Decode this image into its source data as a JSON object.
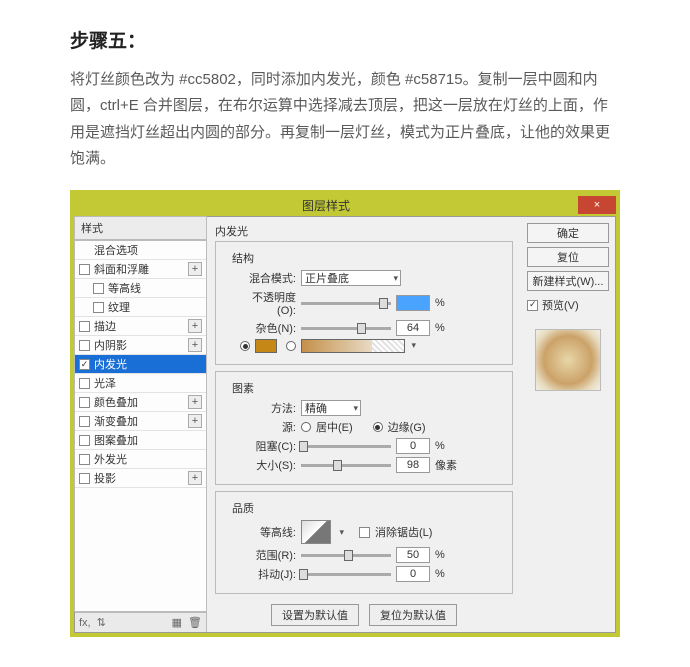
{
  "step_title": "步骤五：",
  "paragraph": "将灯丝颜色改为 #cc5802，同时添加内发光，颜色 #c58715。复制一层中圆和内圆，ctrl+E 合并图层，在布尔运算中选择减去顶层，把这一层放在灯丝的上面，作用是遮挡灯丝超出内圆的部分。再复制一层灯丝，模式为正片叠底，让他的效果更饱满。",
  "dialog": {
    "title": "图层样式",
    "close": "×",
    "styles_header": "样式",
    "items_header": "混合选项",
    "items": [
      {
        "label": "斜面和浮雕",
        "checked": false,
        "plus": true
      },
      {
        "label": "等高线",
        "checked": false,
        "plus": false,
        "indent": true
      },
      {
        "label": "纹理",
        "checked": false,
        "plus": false,
        "indent": true
      },
      {
        "label": "描边",
        "checked": false,
        "plus": true
      },
      {
        "label": "内阴影",
        "checked": false,
        "plus": true
      },
      {
        "label": "内发光",
        "checked": true,
        "plus": false,
        "active": true
      },
      {
        "label": "光泽",
        "checked": false,
        "plus": false
      },
      {
        "label": "颜色叠加",
        "checked": false,
        "plus": true
      },
      {
        "label": "渐变叠加",
        "checked": false,
        "plus": true
      },
      {
        "label": "图案叠加",
        "checked": false,
        "plus": false
      },
      {
        "label": "外发光",
        "checked": false,
        "plus": false
      },
      {
        "label": "投影",
        "checked": false,
        "plus": true
      }
    ],
    "footer": {
      "fx": "fx,"
    }
  },
  "panel": {
    "head": "内发光",
    "sec1": {
      "title": "结构",
      "blend_label": "混合模式:",
      "blend_value": "正片叠底",
      "opacity_label": "不透明度(O):",
      "opacity_val": "",
      "opacity_unit": "%",
      "noise_label": "杂色(N):",
      "noise_val": "64",
      "noise_unit": "%"
    },
    "sec2": {
      "title": "图素",
      "method_label": "方法:",
      "method_value": "精确",
      "source_label": "源:",
      "source_center": "居中(E)",
      "source_edge": "边缘(G)",
      "choke_label": "阻塞(C):",
      "choke_val": "0",
      "choke_unit": "%",
      "size_label": "大小(S):",
      "size_val": "98",
      "size_unit": "像素"
    },
    "sec3": {
      "title": "品质",
      "contour_label": "等高线:",
      "antialias_label": "消除锯齿(L)",
      "range_label": "范围(R):",
      "range_val": "50",
      "range_unit": "%",
      "jitter_label": "抖动(J):",
      "jitter_val": "0",
      "jitter_unit": "%"
    },
    "btn_default": "设置为默认值",
    "btn_reset": "复位为默认值"
  },
  "right": {
    "ok": "确定",
    "cancel": "复位",
    "newstyle": "新建样式(W)...",
    "preview": "预览(V)"
  }
}
